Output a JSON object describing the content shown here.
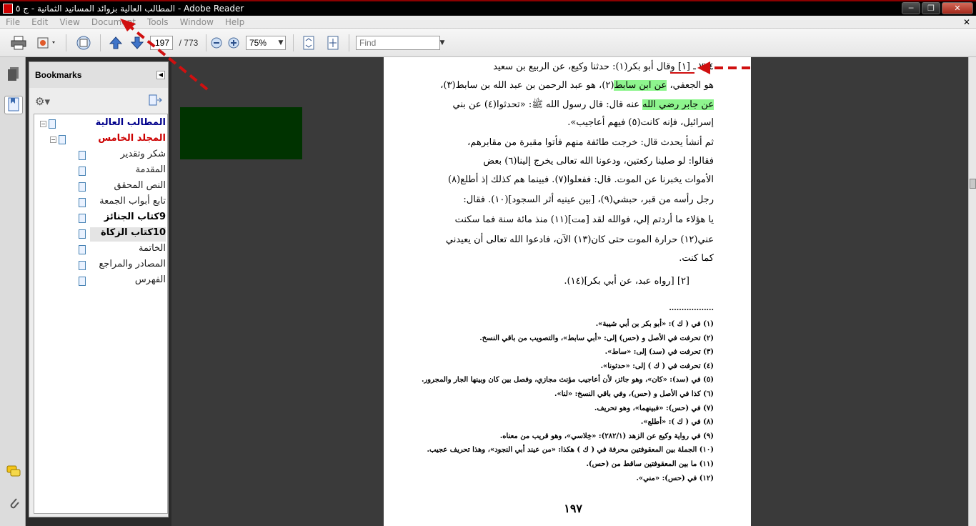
{
  "window": {
    "title": "المطالب العالية بزوائد المسانيد الثمانية - ج ٥ - Adobe Reader",
    "minimize": "─",
    "restore": "❐",
    "close": "✕"
  },
  "menu": [
    "File",
    "Edit",
    "View",
    "Document",
    "Tools",
    "Window",
    "Help"
  ],
  "menu_close": "✕",
  "toolbar": {
    "page_current": "197",
    "page_total": "/ 773",
    "zoom": "75%",
    "find_placeholder": "Find"
  },
  "bookmarks": {
    "title": "Bookmarks",
    "items": [
      {
        "label": "المطالب العالية",
        "level": 0,
        "color": "#00008b",
        "bold": true,
        "expander": "⊟"
      },
      {
        "label": "المجلد الخامس",
        "level": 1,
        "color": "#cc0000",
        "bold": true,
        "expander": "⊟"
      },
      {
        "label": "شكر وتقدير",
        "level": 2,
        "color": "#222222",
        "bold": false
      },
      {
        "label": "المقدمة",
        "level": 2,
        "color": "#222222",
        "bold": false
      },
      {
        "label": "النص المحقق",
        "level": 2,
        "color": "#222222",
        "bold": false
      },
      {
        "label": "تابع أبواب الجمعة",
        "level": 2,
        "color": "#222222",
        "bold": false
      },
      {
        "label": "9كتاب الجنائز",
        "level": 2,
        "color": "#000000",
        "bold": true
      },
      {
        "label": "10كتاب الزكاة",
        "level": 2,
        "color": "#000000",
        "bold": true,
        "selected": true
      },
      {
        "label": "الخاتمة",
        "level": 2,
        "color": "#222222",
        "bold": false
      },
      {
        "label": "المصادر والمراجع",
        "level": 2,
        "color": "#222222",
        "bold": false
      },
      {
        "label": "الفهرس",
        "level": 2,
        "color": "#222222",
        "bold": false
      }
    ]
  },
  "document": {
    "body_lines": [
      {
        "parts": [
          {
            "t": "٧٧٤ ـ [١] وقال أبو بكر"
          },
          {
            "t": "(١)"
          },
          {
            "t": ": حدثنا وكيع، عن الربيع بن سعيد"
          }
        ]
      },
      {
        "parts": [
          {
            "t": "هو الجعفي، "
          },
          {
            "t": "عن ابن سابط",
            "hl": true
          },
          {
            "t": "(٢)، هو عبد الرحمن بن عبد الله بن سابط(٣)،"
          }
        ]
      },
      {
        "parts": [
          {
            "t": "عن جابر رضي الله",
            "hl": true
          },
          {
            "t": " عنه قال: قال رسول الله ﷺ: «تحدثوا(٤) عن بني"
          }
        ]
      },
      {
        "parts": [
          {
            "t": "إسرائيل، فإنه كانت(٥) فيهم أعاجيب»."
          }
        ]
      },
      {
        "parts": [
          {
            "t": "ثم أنشأ يحدث قال: خرجت طائفة منهم فأتوا مقبرة من مقابرهم،"
          }
        ]
      },
      {
        "parts": [
          {
            "t": "فقالوا: لو صلينا ركعتين، ودعونا الله تعالى يخرج إلينا(٦) بعض"
          }
        ]
      },
      {
        "parts": [
          {
            "t": "الأموات يخبرنا عن الموت. قال: ففعلوا(٧). فبينما هم كذلك إذ أطلع(٨)"
          }
        ]
      },
      {
        "parts": [
          {
            "t": "رجل رأسه من قبر، حبشي(٩)، [بين عينيه أثر السجود](١٠). فقال:"
          }
        ]
      },
      {
        "parts": [
          {
            "t": "يا هؤلاء ما أردتم إلي، فوالله لقد [مت](١١) منذ مائة سنة فما سكنت"
          }
        ]
      },
      {
        "parts": [
          {
            "t": "عني(١٢) حرارة الموت حتى كان(١٣) الآن، فادعوا الله تعالى أن يعيدني"
          }
        ]
      },
      {
        "parts": [
          {
            "t": "كما كنت."
          }
        ]
      },
      {
        "parts": [
          {
            "t": "[٢] [رواه عبد، عن أبي بكر](١٤)."
          }
        ]
      }
    ],
    "separator": "..................",
    "footnotes": [
      "(١) في ( ك ): «أبو بكر بن أبي شيبة».",
      "(٢) تحرفت في الأصل و (حس) إلى: «أبي سابط»، والتصويب من باقي النسخ.",
      "(٣) تحرفت في (سد) إلى: «ساط».",
      "(٤) تحرفت في ( ك ) إلى: «حدثونا».",
      "(٥) في (سد): «كان»، وهو جائز، لأن أعاجيب مؤنث مجازي، وفصل بين كان وبينها الجار والمجرور.",
      "(٦) كذا في الأصل و (حس)، وفي باقي النسخ: «لنا».",
      "(٧) في (حس): «فبينهما»، وهو تحريف.",
      "(٨) في ( ك ): «أطلع».",
      "(٩) في رواية وكيع عن الزهد (٢٨٢/١): «خِلاسي»، وهو قريب من معناه.",
      "(١٠) الجملة بين المعقوفتين محرفة في ( ك ) هكذا: «من عيند أبي النجود»، وهذا تحريف عجيب.",
      "(١١) ما بين المعقوفتين ساقط من (حس).",
      "(١٢) في (حس): «مني»."
    ],
    "page_number": "١٩٧"
  }
}
